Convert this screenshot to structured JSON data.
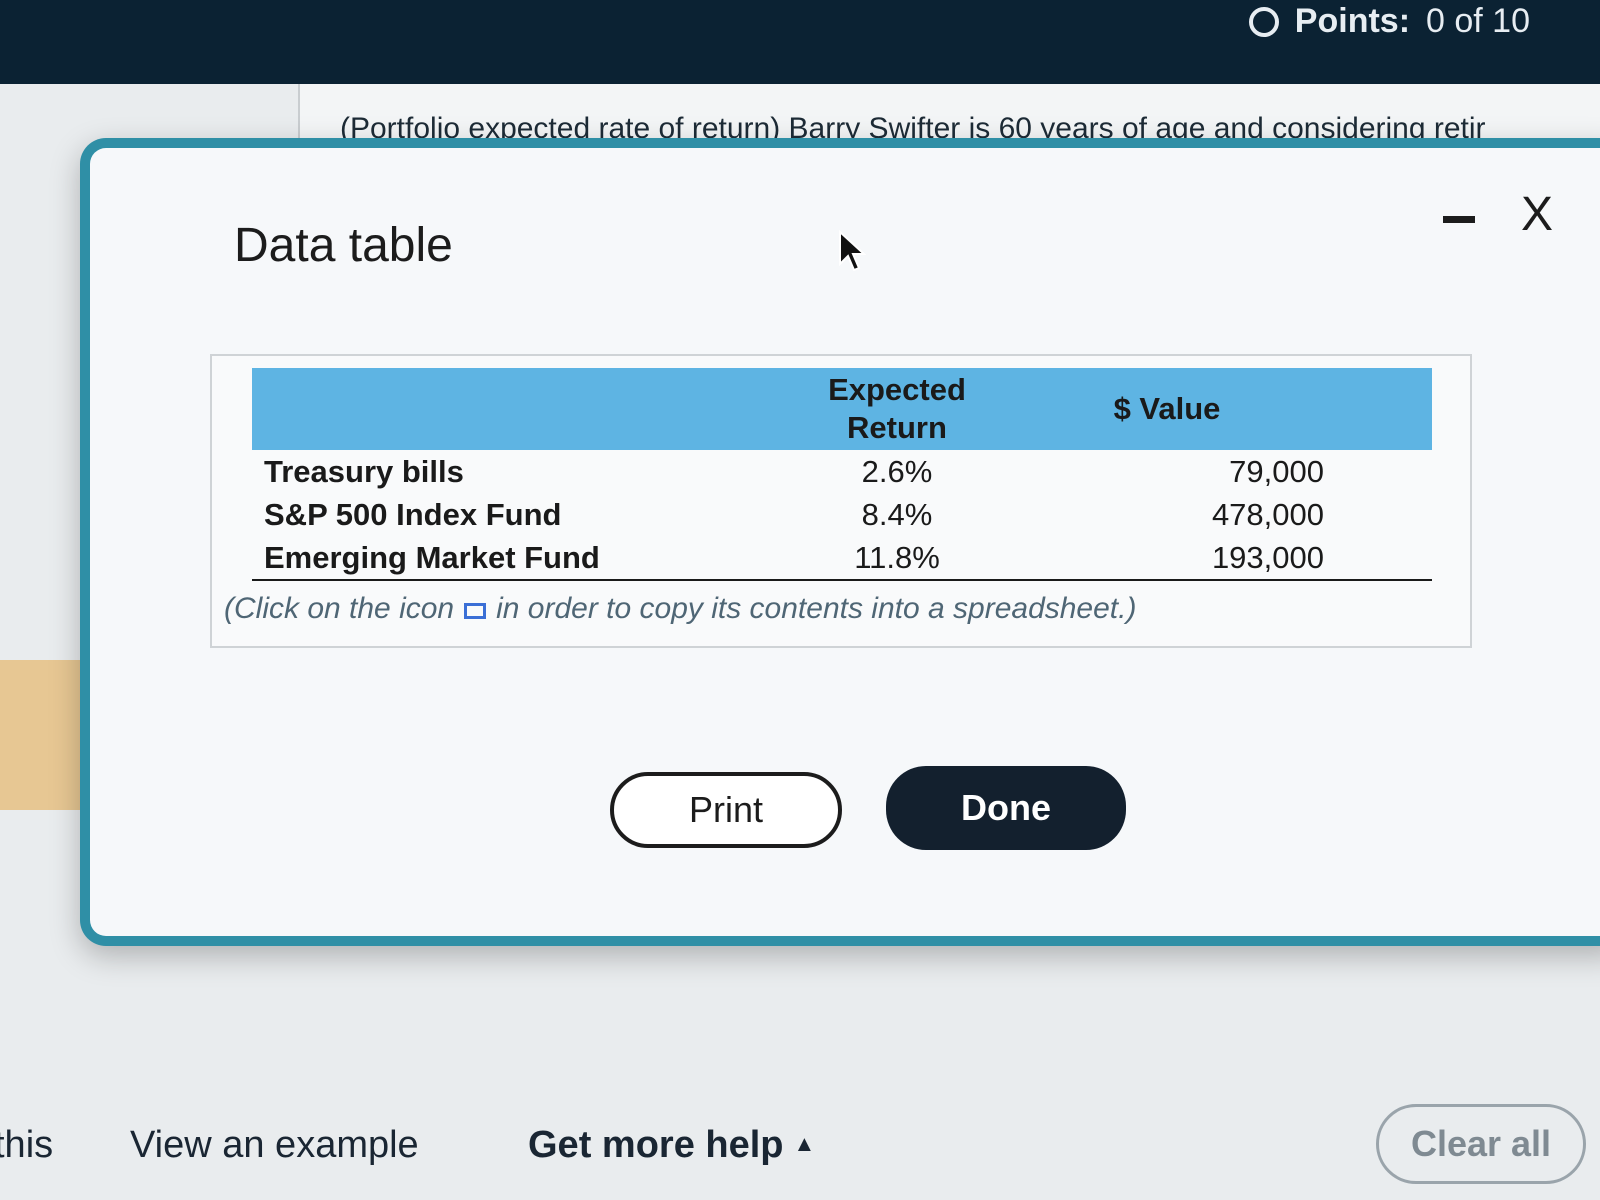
{
  "header": {
    "points_label": "Points:",
    "points_value": "0 of 10"
  },
  "question": {
    "text": "(Portfolio expected rate of return)  Barry Swifter is 60 years of age and considering retir"
  },
  "dialog": {
    "title": "Data table",
    "minimize_icon": "minimize-icon",
    "close_label": "X",
    "table": {
      "headers": [
        "",
        "Expected Return",
        "$ Value"
      ],
      "header_return_line1": "Expected",
      "header_return_line2": "Return",
      "rows": [
        {
          "name": "Treasury bills",
          "expected_return": "2.6%",
          "value": "79,000"
        },
        {
          "name": "S&P 500 Index Fund",
          "expected_return": "8.4%",
          "value": "478,000"
        },
        {
          "name": "Emerging Market Fund",
          "expected_return": "11.8%",
          "value": "193,000"
        }
      ]
    },
    "copy_note_before": "(Click on the icon",
    "copy_note_after": "in order to copy its contents into a spreadsheet.)",
    "print_label": "Print",
    "done_label": "Done"
  },
  "footer": {
    "this_label": "this",
    "view_example_label": "View an example",
    "get_help_label": "Get more help",
    "get_help_caret": "▲",
    "clear_all_label": "Clear all"
  },
  "colors": {
    "header_bar": "#0b2233",
    "dialog_border": "#2f8fa6",
    "table_header": "#5eb4e3",
    "done_button": "#13202e"
  }
}
